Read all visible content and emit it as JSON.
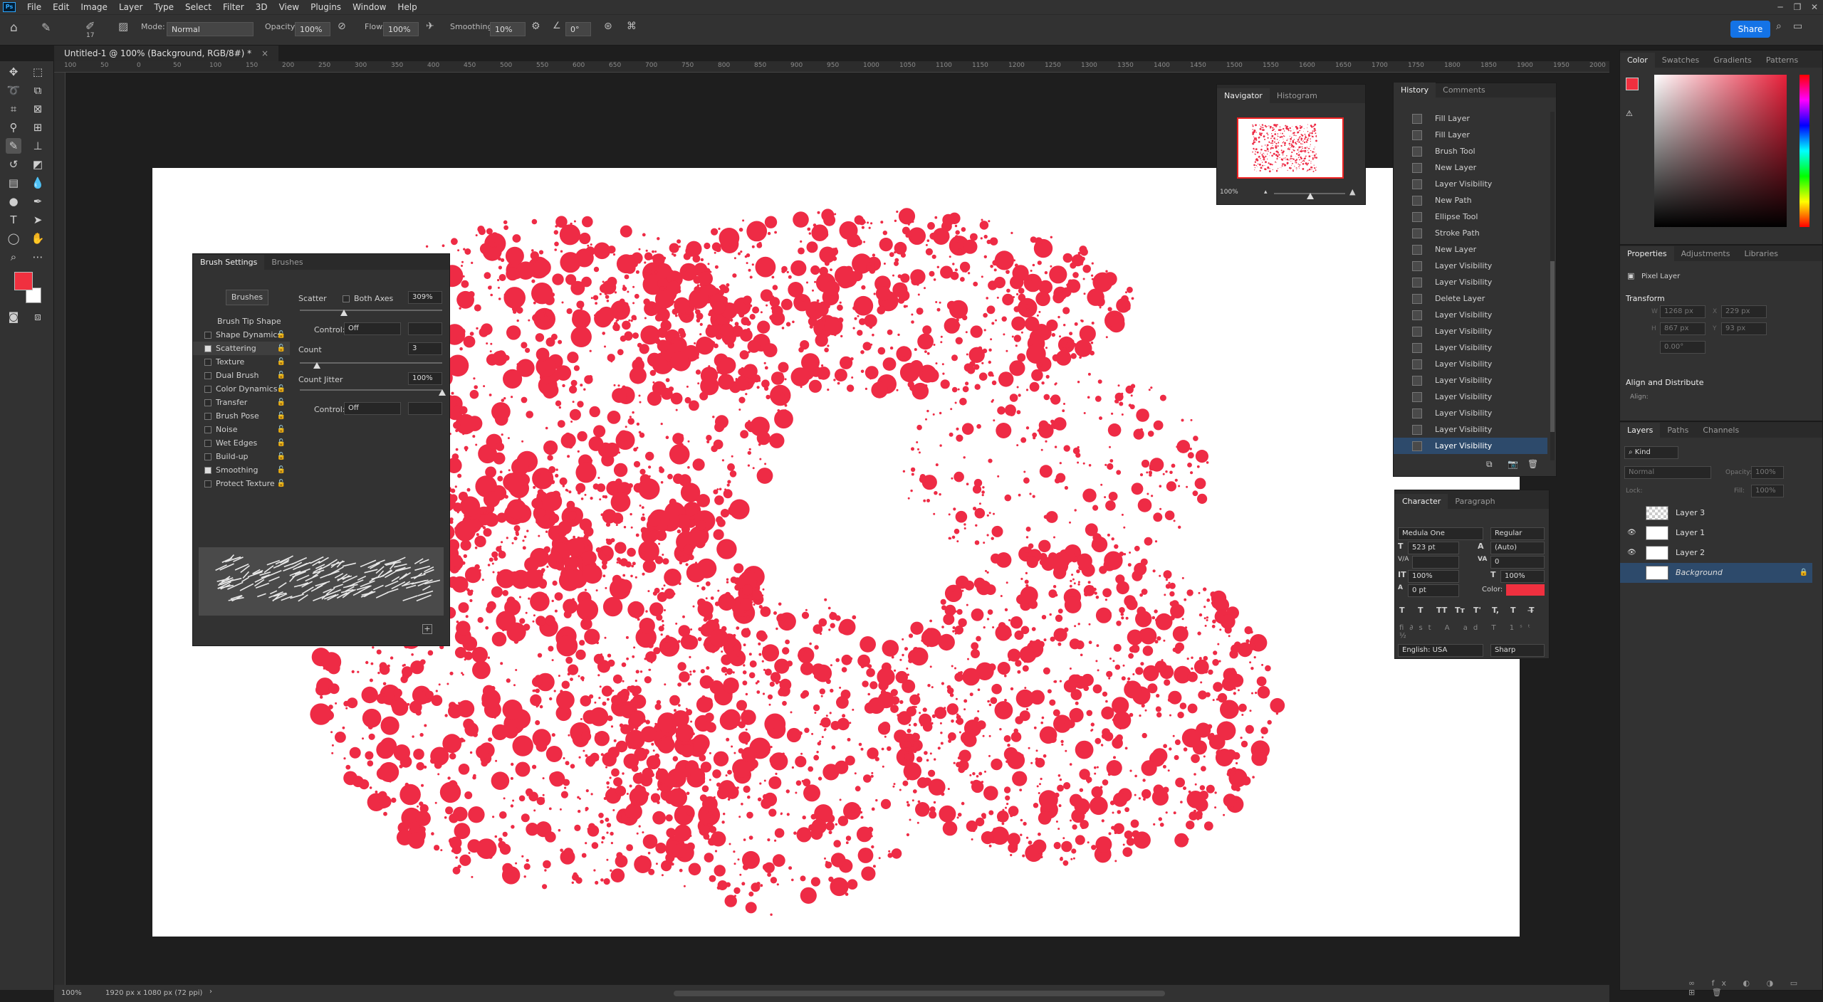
{
  "app": {
    "logo": "Ps",
    "menu": [
      "File",
      "Edit",
      "Image",
      "Layer",
      "Type",
      "Select",
      "Filter",
      "3D",
      "View",
      "Plugins",
      "Window",
      "Help"
    ],
    "window_controls": [
      "─",
      "❐",
      "✕"
    ],
    "share": "Share"
  },
  "options": {
    "brush_size": "17",
    "mode_label": "Mode:",
    "mode": "Normal",
    "opacity_label": "Opacity:",
    "opacity": "100%",
    "flow_label": "Flow:",
    "flow": "100%",
    "smoothing_label": "Smoothing:",
    "smoothing": "10%",
    "angle": "0°"
  },
  "doc_tab": {
    "title": "Untitled-1 @ 100% (Background, RGB/8#) *",
    "close": "×"
  },
  "ruler": [
    "100",
    "50",
    "0",
    "50",
    "100",
    "150",
    "200",
    "250",
    "300",
    "350",
    "400",
    "450",
    "500",
    "550",
    "600",
    "650",
    "700",
    "750",
    "800",
    "850",
    "900",
    "950",
    "1000",
    "1050",
    "1100",
    "1150",
    "1200",
    "1250",
    "1300",
    "1350",
    "1400",
    "1450",
    "1500",
    "1550",
    "1600",
    "1650",
    "1700",
    "1750",
    "1800",
    "1850",
    "1900",
    "1950",
    "2000"
  ],
  "colors": {
    "foreground": "#f0303f",
    "background": "#ffffff",
    "splatter": "#ee2b45",
    "accent": "#1473e6",
    "selected": "#2d4a6b"
  },
  "brush_settings": {
    "tabs": [
      "Brush Settings",
      "Brushes"
    ],
    "brushes_button": "Brushes",
    "tip_shape": "Brush Tip Shape",
    "options": [
      {
        "label": "Shape Dynamics",
        "checked": false
      },
      {
        "label": "Scattering",
        "checked": true
      },
      {
        "label": "Texture",
        "checked": false
      },
      {
        "label": "Dual Brush",
        "checked": false
      },
      {
        "label": "Color Dynamics",
        "checked": false
      },
      {
        "label": "Transfer",
        "checked": false
      },
      {
        "label": "Brush Pose",
        "checked": false
      },
      {
        "label": "Noise",
        "checked": false
      },
      {
        "label": "Wet Edges",
        "checked": false
      },
      {
        "label": "Build-up",
        "checked": false
      },
      {
        "label": "Smoothing",
        "checked": true
      },
      {
        "label": "Protect Texture",
        "checked": false
      }
    ],
    "scatter_label": "Scatter",
    "both_axes": "Both Axes",
    "scatter_value": "309%",
    "control_label": "Control:",
    "control_value": "Off",
    "count_label": "Count",
    "count_value": "3",
    "count_jitter_label": "Count Jitter",
    "count_jitter_value": "100%",
    "control2_value": "Off",
    "scatter_fraction": 0.31,
    "count_fraction": 0.12,
    "count_jitter_fraction": 1.0
  },
  "navigator": {
    "tabs": [
      "Navigator",
      "Histogram"
    ],
    "zoom": "100%"
  },
  "history": {
    "tabs": [
      "History",
      "Comments"
    ],
    "items": [
      "Fill Layer",
      "Fill Layer",
      "Brush Tool",
      "New Layer",
      "Layer Visibility",
      "New Path",
      "Ellipse Tool",
      "Stroke Path",
      "New Layer",
      "Layer Visibility",
      "Layer Visibility",
      "Delete Layer",
      "Layer Visibility",
      "Layer Visibility",
      "Layer Visibility",
      "Layer Visibility",
      "Layer Visibility",
      "Layer Visibility",
      "Layer Visibility",
      "Layer Visibility",
      "Layer Visibility"
    ]
  },
  "character": {
    "tabs": [
      "Character",
      "Paragraph"
    ],
    "font": "Medula One",
    "style": "Regular",
    "size": "523 pt",
    "leading": "(Auto)",
    "kerning_label": "V/A",
    "tracking": "0",
    "vscale": "100%",
    "hscale": "100%",
    "baseline": "0 pt",
    "color_label": "Color:",
    "language": "English: USA",
    "antialias": "Sharp",
    "styles": [
      "T",
      "T",
      "TT",
      "Tт",
      "T'",
      "T,",
      "T",
      "T̶"
    ]
  },
  "color_panel": {
    "tabs": [
      "Color",
      "Swatches",
      "Gradients",
      "Patterns"
    ]
  },
  "properties": {
    "tabs": [
      "Properties",
      "Adjustments",
      "Libraries"
    ],
    "type": "Pixel Layer",
    "transform": "Transform",
    "w": "1268 px",
    "h": "867 px",
    "x": "229 px",
    "y": "93 px",
    "angle": "0.00°",
    "align": "Align and Distribute",
    "align_label": "Align:"
  },
  "layers": {
    "tabs": [
      "Layers",
      "Paths",
      "Channels"
    ],
    "kind": "Kind",
    "blend": "Normal",
    "opacity_label": "Opacity:",
    "opacity": "100%",
    "lock_label": "Lock:",
    "fill_label": "Fill:",
    "fill": "100%",
    "items": [
      {
        "name": "Layer 3",
        "visible": false
      },
      {
        "name": "Layer 1",
        "visible": true
      },
      {
        "name": "Layer 2",
        "visible": true
      },
      {
        "name": "Background",
        "visible": false
      }
    ]
  },
  "status": {
    "zoom": "100%",
    "doc_info": "1920 px x 1080 px (72 ppi)"
  }
}
